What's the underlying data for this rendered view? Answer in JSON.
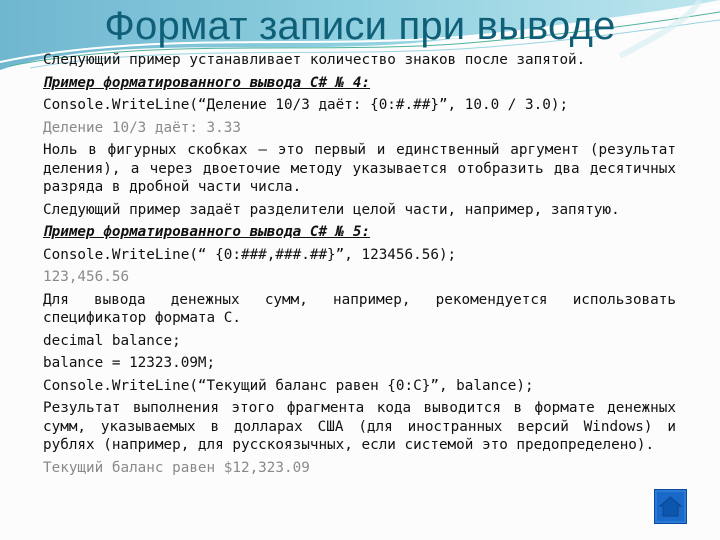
{
  "slide": {
    "title": "Формат записи при выводе",
    "colors": {
      "title": "#0f5f78",
      "body_text": "#111111",
      "output_text": "#8a8a8a",
      "home_button": "#1a68c8"
    }
  },
  "content": {
    "intro": "Следующий пример устанавливает количество знаков после запятой.",
    "example4": {
      "heading": "Пример форматированного вывода C# № 4:",
      "code": "Console.WriteLine(“Деление 10/3 даёт: {0:#.##}”, 10.0 / 3.0);",
      "output": "Деление 10/3 даёт: 3.33",
      "explanation": "Ноль в фигурных скобках – это первый и единственный аргумент (результат деления), а через двоеточие методу указывается отобразить два десятичных разряда в дробной части числа."
    },
    "separator_intro": "Следующий пример задаёт разделители целой части, например, запятую.",
    "example5": {
      "heading": "Пример форматированного вывода C# № 5:",
      "code": "Console.WriteLine(“ {0:###,###.##}”, 123456.56);",
      "output": "123,456.56"
    },
    "currency_intro": "Для вывода денежных сумм, например, рекомендуется использовать спецификатор формата C.",
    "currency_code": [
      "decimal balance;",
      "balance = 12323.09M;",
      "Console.WriteLine(“Текущий баланс равен {0:C}”, balance);"
    ],
    "currency_result": "Результат выполнения этого фрагмента кода выводится в формате денежных сумм, указываемых в долларах США (для иностранных версий Windows) и рублях (например, для русскоязычных, если системой это предопределено).",
    "currency_output": "Текущий баланс равен $12,323.09"
  },
  "navigation": {
    "home_icon": "home-icon"
  }
}
